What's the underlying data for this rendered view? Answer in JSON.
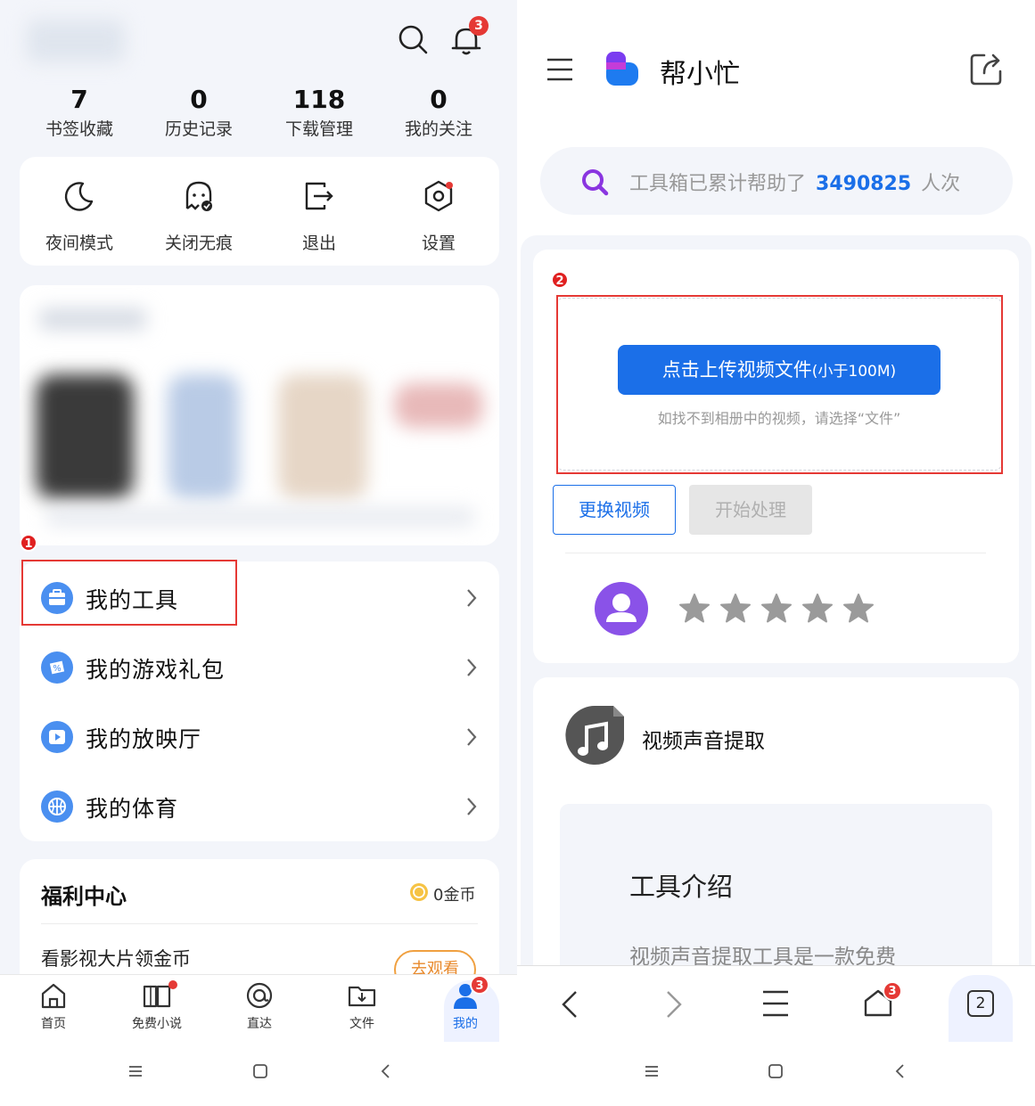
{
  "left": {
    "header": {
      "notification_badge": "3"
    },
    "stats": [
      {
        "value": "7",
        "label": "书签收藏"
      },
      {
        "value": "0",
        "label": "历史记录"
      },
      {
        "value": "118",
        "label": "下载管理"
      },
      {
        "value": "0",
        "label": "我的关注"
      }
    ],
    "quick_actions": [
      {
        "label": "夜间模式",
        "icon": "moon-icon"
      },
      {
        "label": "关闭无痕",
        "icon": "incognito-icon"
      },
      {
        "label": "退出",
        "icon": "logout-icon"
      },
      {
        "label": "设置",
        "icon": "settings-icon"
      }
    ],
    "step1": "1",
    "menu": [
      {
        "label": "我的工具",
        "icon": "toolbox-icon"
      },
      {
        "label": "我的游戏礼包",
        "icon": "game-gift-icon"
      },
      {
        "label": "我的放映厅",
        "icon": "play-icon"
      },
      {
        "label": "我的体育",
        "icon": "basketball-icon"
      }
    ],
    "welfare": {
      "title": "福利中心",
      "coins": "0金币",
      "task": "看影视大片领金币",
      "task_button": "去观看"
    },
    "tabs": [
      {
        "label": "首页",
        "icon": "home-icon"
      },
      {
        "label": "免费小说",
        "icon": "book-icon"
      },
      {
        "label": "直达",
        "icon": "direct-icon"
      },
      {
        "label": "文件",
        "icon": "folder-icon"
      },
      {
        "label": "我的",
        "icon": "profile-icon",
        "badge": "3"
      }
    ]
  },
  "right": {
    "app_title": "帮小忙",
    "search": {
      "prefix": "工具箱已累计帮助了",
      "count": "3490825",
      "suffix": "人次"
    },
    "step2": "2",
    "upload": {
      "button": "点击上传视频文件",
      "button_hint": "(小于100M)",
      "tip": "如找不到相册中的视频，请选择“文件”"
    },
    "change_video": "更换视频",
    "start_process": "开始处理",
    "tool_name": "视频声音提取",
    "intro_title": "工具介绍",
    "intro_text": "视频声音提取工具是一款免费",
    "browser": {
      "tab_count": "2",
      "home_badge": "3"
    }
  },
  "colors": {
    "accent": "#1b6fe8",
    "badge": "#e53935",
    "highlight": "#e53935"
  }
}
